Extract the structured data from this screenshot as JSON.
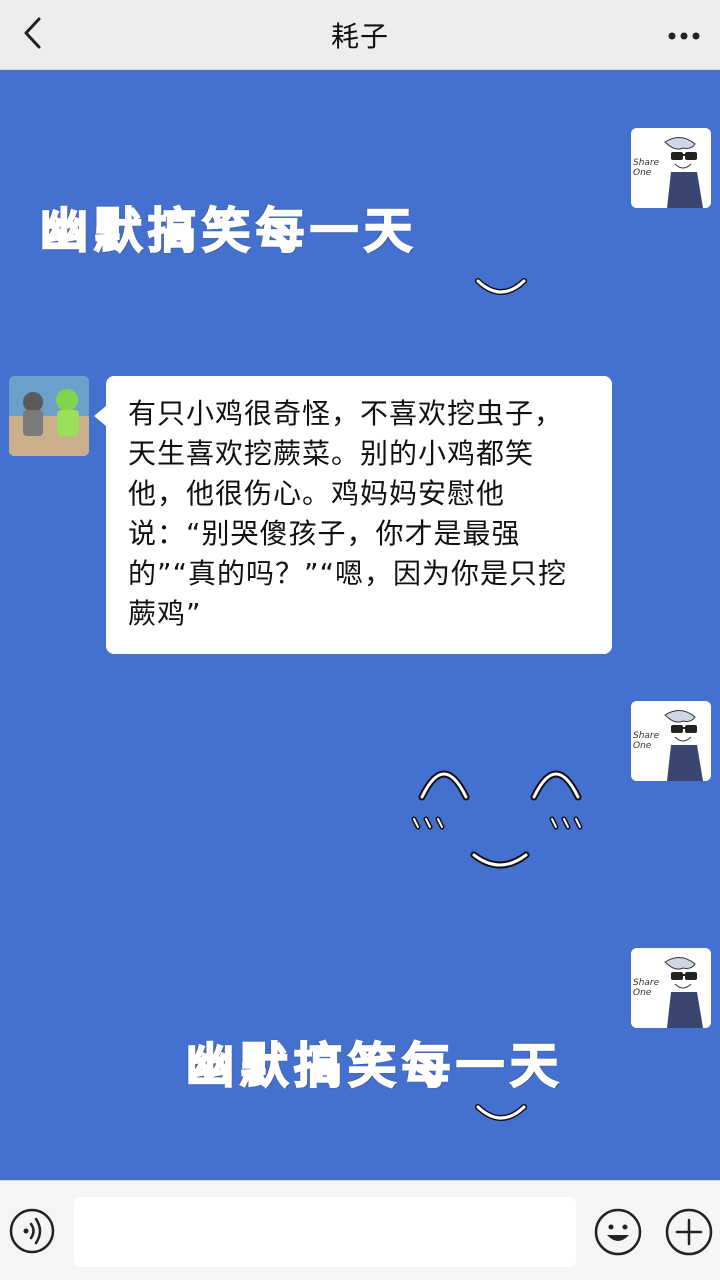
{
  "header": {
    "title": "耗子",
    "back_icon": "chevron-left-icon",
    "more_icon": "more-dots-icon"
  },
  "messages": [
    {
      "side": "right",
      "type": "sticker",
      "text": "幽默搞笑每一天"
    },
    {
      "side": "left",
      "type": "text",
      "text": "有只小鸡很奇怪，不喜欢挖虫子，天生喜欢挖蕨菜。别的小鸡都笑他，他很伤心。鸡妈妈安慰他说：“别哭傻孩子，你才是最强的”“真的吗？”“嗯，因为你是只挖蕨鸡”"
    },
    {
      "side": "right",
      "type": "sticker",
      "text": ""
    },
    {
      "side": "right",
      "type": "sticker",
      "text": "幽默搞笑每一天"
    }
  ],
  "avatar_label": "Share One",
  "footer": {
    "input_value": "",
    "voice_icon": "voice-icon",
    "emoji_icon": "emoji-icon",
    "add_icon": "plus-circle-icon"
  },
  "colors": {
    "chat_background": "#4470cf",
    "header_background": "#ededed",
    "bubble_background": "#ffffff"
  }
}
